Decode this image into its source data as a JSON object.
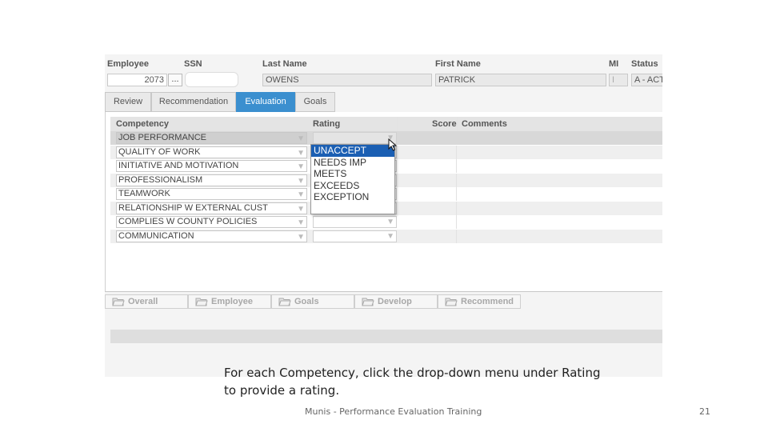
{
  "header": {
    "labels": {
      "employee": "Employee",
      "ssn": "SSN",
      "last_name": "Last Name",
      "first_name": "First Name",
      "mi": "MI",
      "status": "Status"
    },
    "values": {
      "employee": "2073",
      "lookup": "...",
      "last_name": "OWENS",
      "first_name": "PATRICK",
      "mi": "I",
      "status": "A - ACT"
    }
  },
  "tabs": [
    {
      "label": "Review",
      "active": false
    },
    {
      "label": "Recommendation",
      "active": false
    },
    {
      "label": "Evaluation",
      "active": true
    },
    {
      "label": "Goals",
      "active": false
    }
  ],
  "grid": {
    "columns": {
      "competency": "Competency",
      "rating": "Rating",
      "score": "Score",
      "comments": "Comments"
    },
    "rows": [
      {
        "competency": "JOB PERFORMANCE"
      },
      {
        "competency": "QUALITY OF WORK"
      },
      {
        "competency": "INITIATIVE AND MOTIVATION"
      },
      {
        "competency": "PROFESSIONALISM"
      },
      {
        "competency": "TEAMWORK"
      },
      {
        "competency": "RELATIONSHIP W EXTERNAL CUST"
      },
      {
        "competency": "COMPLIES W COUNTY POLICIES"
      },
      {
        "competency": "COMMUNICATION"
      }
    ]
  },
  "rating_dropdown": {
    "options": [
      "UNACCEPT",
      "NEEDS IMP",
      "MEETS",
      "EXCEEDS",
      "EXCEPTION"
    ],
    "highlighted": "UNACCEPT"
  },
  "bottom_buttons": [
    {
      "label": "Overall",
      "icon": "folder-open-icon"
    },
    {
      "label": "Employee",
      "icon": "folder-open-icon"
    },
    {
      "label": "Goals",
      "icon": "folder-open-icon"
    },
    {
      "label": "Develop",
      "icon": "folder-open-icon"
    },
    {
      "label": "Recommend",
      "icon": "folder-open-icon"
    }
  ],
  "slide": {
    "caption_line1": "For each Competency, click the drop-down menu under Rating",
    "caption_line2": "to provide a rating.",
    "footer": "Munis - Performance Evaluation Training",
    "page_number": "21"
  },
  "colors": {
    "active_tab": "#3b8fcf",
    "dropdown_highlight": "#1b5fb3"
  }
}
